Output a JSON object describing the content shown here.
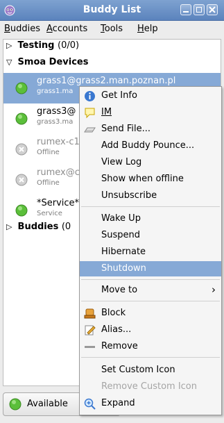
{
  "window": {
    "title": "Buddy List"
  },
  "menubar": [
    {
      "label": "Buddies",
      "mnemonic": "B",
      "rest": "uddies"
    },
    {
      "label": "Accounts",
      "mnemonic": "A",
      "rest": "ccounts"
    },
    {
      "label": "Tools",
      "mnemonic": "T",
      "rest": "ools"
    },
    {
      "label": "Help",
      "mnemonic": "H",
      "rest": "elp"
    }
  ],
  "groups": {
    "testing": {
      "name": "Testing",
      "count": "(0/0)"
    },
    "smoa": {
      "name": "Smoa Devices"
    },
    "buddies": {
      "name": "Buddies",
      "count": "(0"
    }
  },
  "buddies": [
    {
      "name": "grass1@grass2.man.poznan.pl",
      "sub": "grass1.ma",
      "status": "available"
    },
    {
      "name": "grass3@",
      "sub": "grass3.ma",
      "status": "available"
    },
    {
      "name": "rumex-c1",
      "sub": "Offline",
      "status": "offline"
    },
    {
      "name": "rumex@c",
      "sub": "Offline",
      "status": "offline"
    },
    {
      "name": "*Service*",
      "sub": "Service",
      "status": "available"
    }
  ],
  "status_selector": {
    "label": "Available"
  },
  "context_menu": {
    "get_info": "Get Info",
    "im": "IM",
    "send_file": "Send File...",
    "add_pounce": "Add Buddy Pounce...",
    "view_log": "View Log",
    "show_offline": "Show when offline",
    "unsubscribe": "Unsubscribe",
    "wake_up": "Wake Up",
    "suspend": "Suspend",
    "hibernate": "Hibernate",
    "shutdown": "Shutdown",
    "move_to": "Move to",
    "block": "Block",
    "alias": "Alias...",
    "remove": "Remove",
    "set_icon": "Set Custom Icon",
    "remove_icon": "Remove Custom Icon",
    "expand": "Expand"
  },
  "colors": {
    "selection": "#86a9d6",
    "titlebar": "#6b8fc6",
    "available": "#5bbf3a",
    "offline": "#a0a0a0"
  }
}
